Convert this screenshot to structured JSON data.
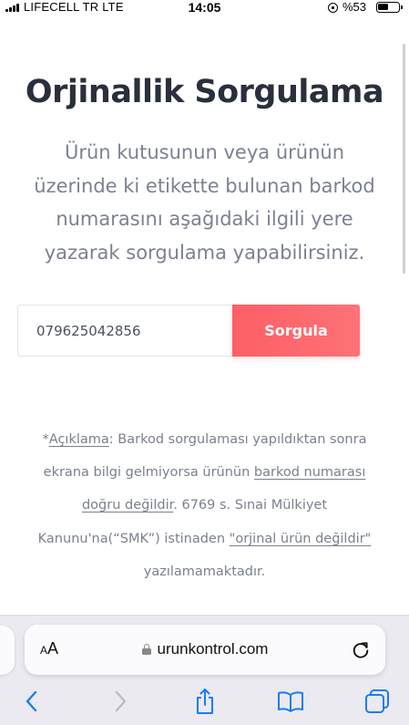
{
  "status_bar": {
    "carrier": "LIFECELL TR  LTE",
    "time": "14:05",
    "battery_percent": "%53",
    "battery_level": 0.53
  },
  "main": {
    "title": "Orjinallik Sorgulama",
    "description": "Ürün kutusunun veya ürünün üzerinde ki etikette bulunan barkod numarasını aşağıdaki ilgili yere yazarak sorgulama yapabilirsiniz.",
    "barcode_value": "079625042856",
    "submit_label": "Sorgula"
  },
  "note": {
    "prefix": "*",
    "link_aciklama": "Açıklama",
    "text1": ": Barkod sorgulaması yapıldıktan sonra ekrana bilgi gelmiyorsa ürünün ",
    "link_barkod": "barkod numarası doğru değildir",
    "text2": ". 6769 s. Sınai Mülkiyet Kanunu'na(“SMK”) istinaden ",
    "link_orjinal": "\"orjinal ürün değildir\"",
    "text3": " yazılamamaktadır."
  },
  "browser": {
    "aa_small": "A",
    "aa_big": "A",
    "url": "urunkontrol.com"
  },
  "colors": {
    "accent": "#fd6268",
    "ios_blue": "#1a7cf5",
    "title": "#2a2f3d",
    "muted_text": "#7b8190"
  }
}
